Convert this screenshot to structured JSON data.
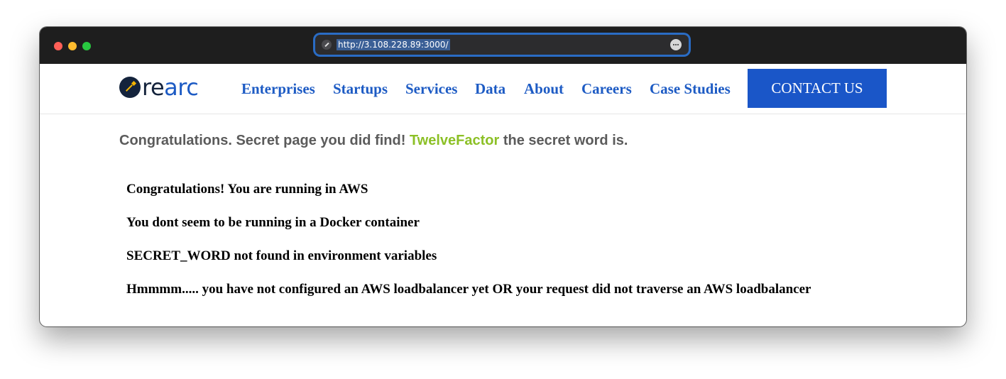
{
  "browser": {
    "url": "http://3.108.228.89:3000/"
  },
  "logo": {
    "part1": "re",
    "part2": "arc",
    "mark_color": "#14233c",
    "accent_color": "#1d5bc4"
  },
  "nav": {
    "items": [
      {
        "label": "Enterprises"
      },
      {
        "label": "Startups"
      },
      {
        "label": "Services"
      },
      {
        "label": "Data"
      },
      {
        "label": "About"
      },
      {
        "label": "Careers"
      },
      {
        "label": "Case Studies"
      }
    ],
    "contact_label": "CONTACT US"
  },
  "secret": {
    "prefix": "Congratulations. Secret page you did find!",
    "word": "TwelveFactor",
    "suffix": "the secret word is."
  },
  "status_lines": [
    "Congratulations! You are running in AWS",
    "You dont seem to be running in a Docker container",
    "SECRET_WORD not found in environment variables",
    "Hmmmm..... you have not configured an AWS loadbalancer yet OR your request did not traverse an AWS loadbalancer"
  ],
  "colors": {
    "nav_link": "#1d5bc4",
    "contact_bg": "#1a56c8",
    "secret_word": "#8cc026",
    "secret_text": "#5b5b5b"
  }
}
